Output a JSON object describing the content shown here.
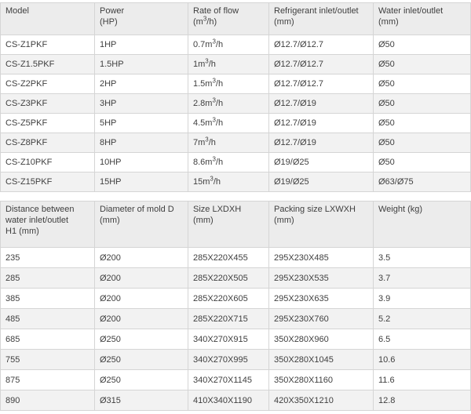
{
  "table1": {
    "headers": [
      [
        "Model"
      ],
      [
        "Power",
        "(HP)"
      ],
      [
        "Rate of flow",
        "(m³/h)"
      ],
      [
        "Refrigerant inlet/outlet",
        "(mm)"
      ],
      [
        "Water inlet/outlet",
        "(mm)"
      ]
    ],
    "rows": [
      [
        "CS-Z1PKF",
        "1HP",
        "0.7m³/h",
        "Ø12.7/Ø12.7",
        "Ø50"
      ],
      [
        "CS-Z1.5PKF",
        "1.5HP",
        "1m³/h",
        "Ø12.7/Ø12.7",
        "Ø50"
      ],
      [
        "CS-Z2PKF",
        "2HP",
        "1.5m³/h",
        "Ø12.7/Ø12.7",
        "Ø50"
      ],
      [
        "CS-Z3PKF",
        "3HP",
        "2.8m³/h",
        "Ø12.7/Ø19",
        "Ø50"
      ],
      [
        "CS-Z5PKF",
        "5HP",
        "4.5m³/h",
        "Ø12.7/Ø19",
        "Ø50"
      ],
      [
        "CS-Z8PKF",
        "8HP",
        "7m³/h",
        "Ø12.7/Ø19",
        "Ø50"
      ],
      [
        "CS-Z10PKF",
        "10HP",
        "8.6m³/h",
        "Ø19/Ø25",
        "Ø50"
      ],
      [
        "CS-Z15PKF",
        "15HP",
        "15m³/h",
        "Ø19/Ø25",
        "Ø63/Ø75"
      ]
    ]
  },
  "table2": {
    "headers": [
      [
        "Distance between",
        "water inlet/outlet",
        "H1 (mm)"
      ],
      [
        "Diameter of mold D",
        "(mm)"
      ],
      [
        "Size LXDXH",
        "(mm)"
      ],
      [
        "Packing size LXWXH",
        "(mm)"
      ],
      [
        "Weight (kg)"
      ]
    ],
    "rows": [
      [
        "235",
        "Ø200",
        "285X220X455",
        "295X230X485",
        "3.5"
      ],
      [
        "285",
        "Ø200",
        "285X220X505",
        "295X230X535",
        "3.7"
      ],
      [
        "385",
        "Ø200",
        "285X220X605",
        "295X230X635",
        "3.9"
      ],
      [
        "485",
        "Ø200",
        "285X220X715",
        "295X230X760",
        "5.2"
      ],
      [
        "685",
        "Ø250",
        "340X270X915",
        "350X280X960",
        "6.5"
      ],
      [
        "755",
        "Ø250",
        "340X270X995",
        "350X280X1045",
        "10.6"
      ],
      [
        "875",
        "Ø250",
        "340X270X1145",
        "350X280X1160",
        "11.6"
      ],
      [
        "890",
        "Ø315",
        "410X340X1190",
        "420X350X1210",
        "12.8"
      ]
    ]
  }
}
